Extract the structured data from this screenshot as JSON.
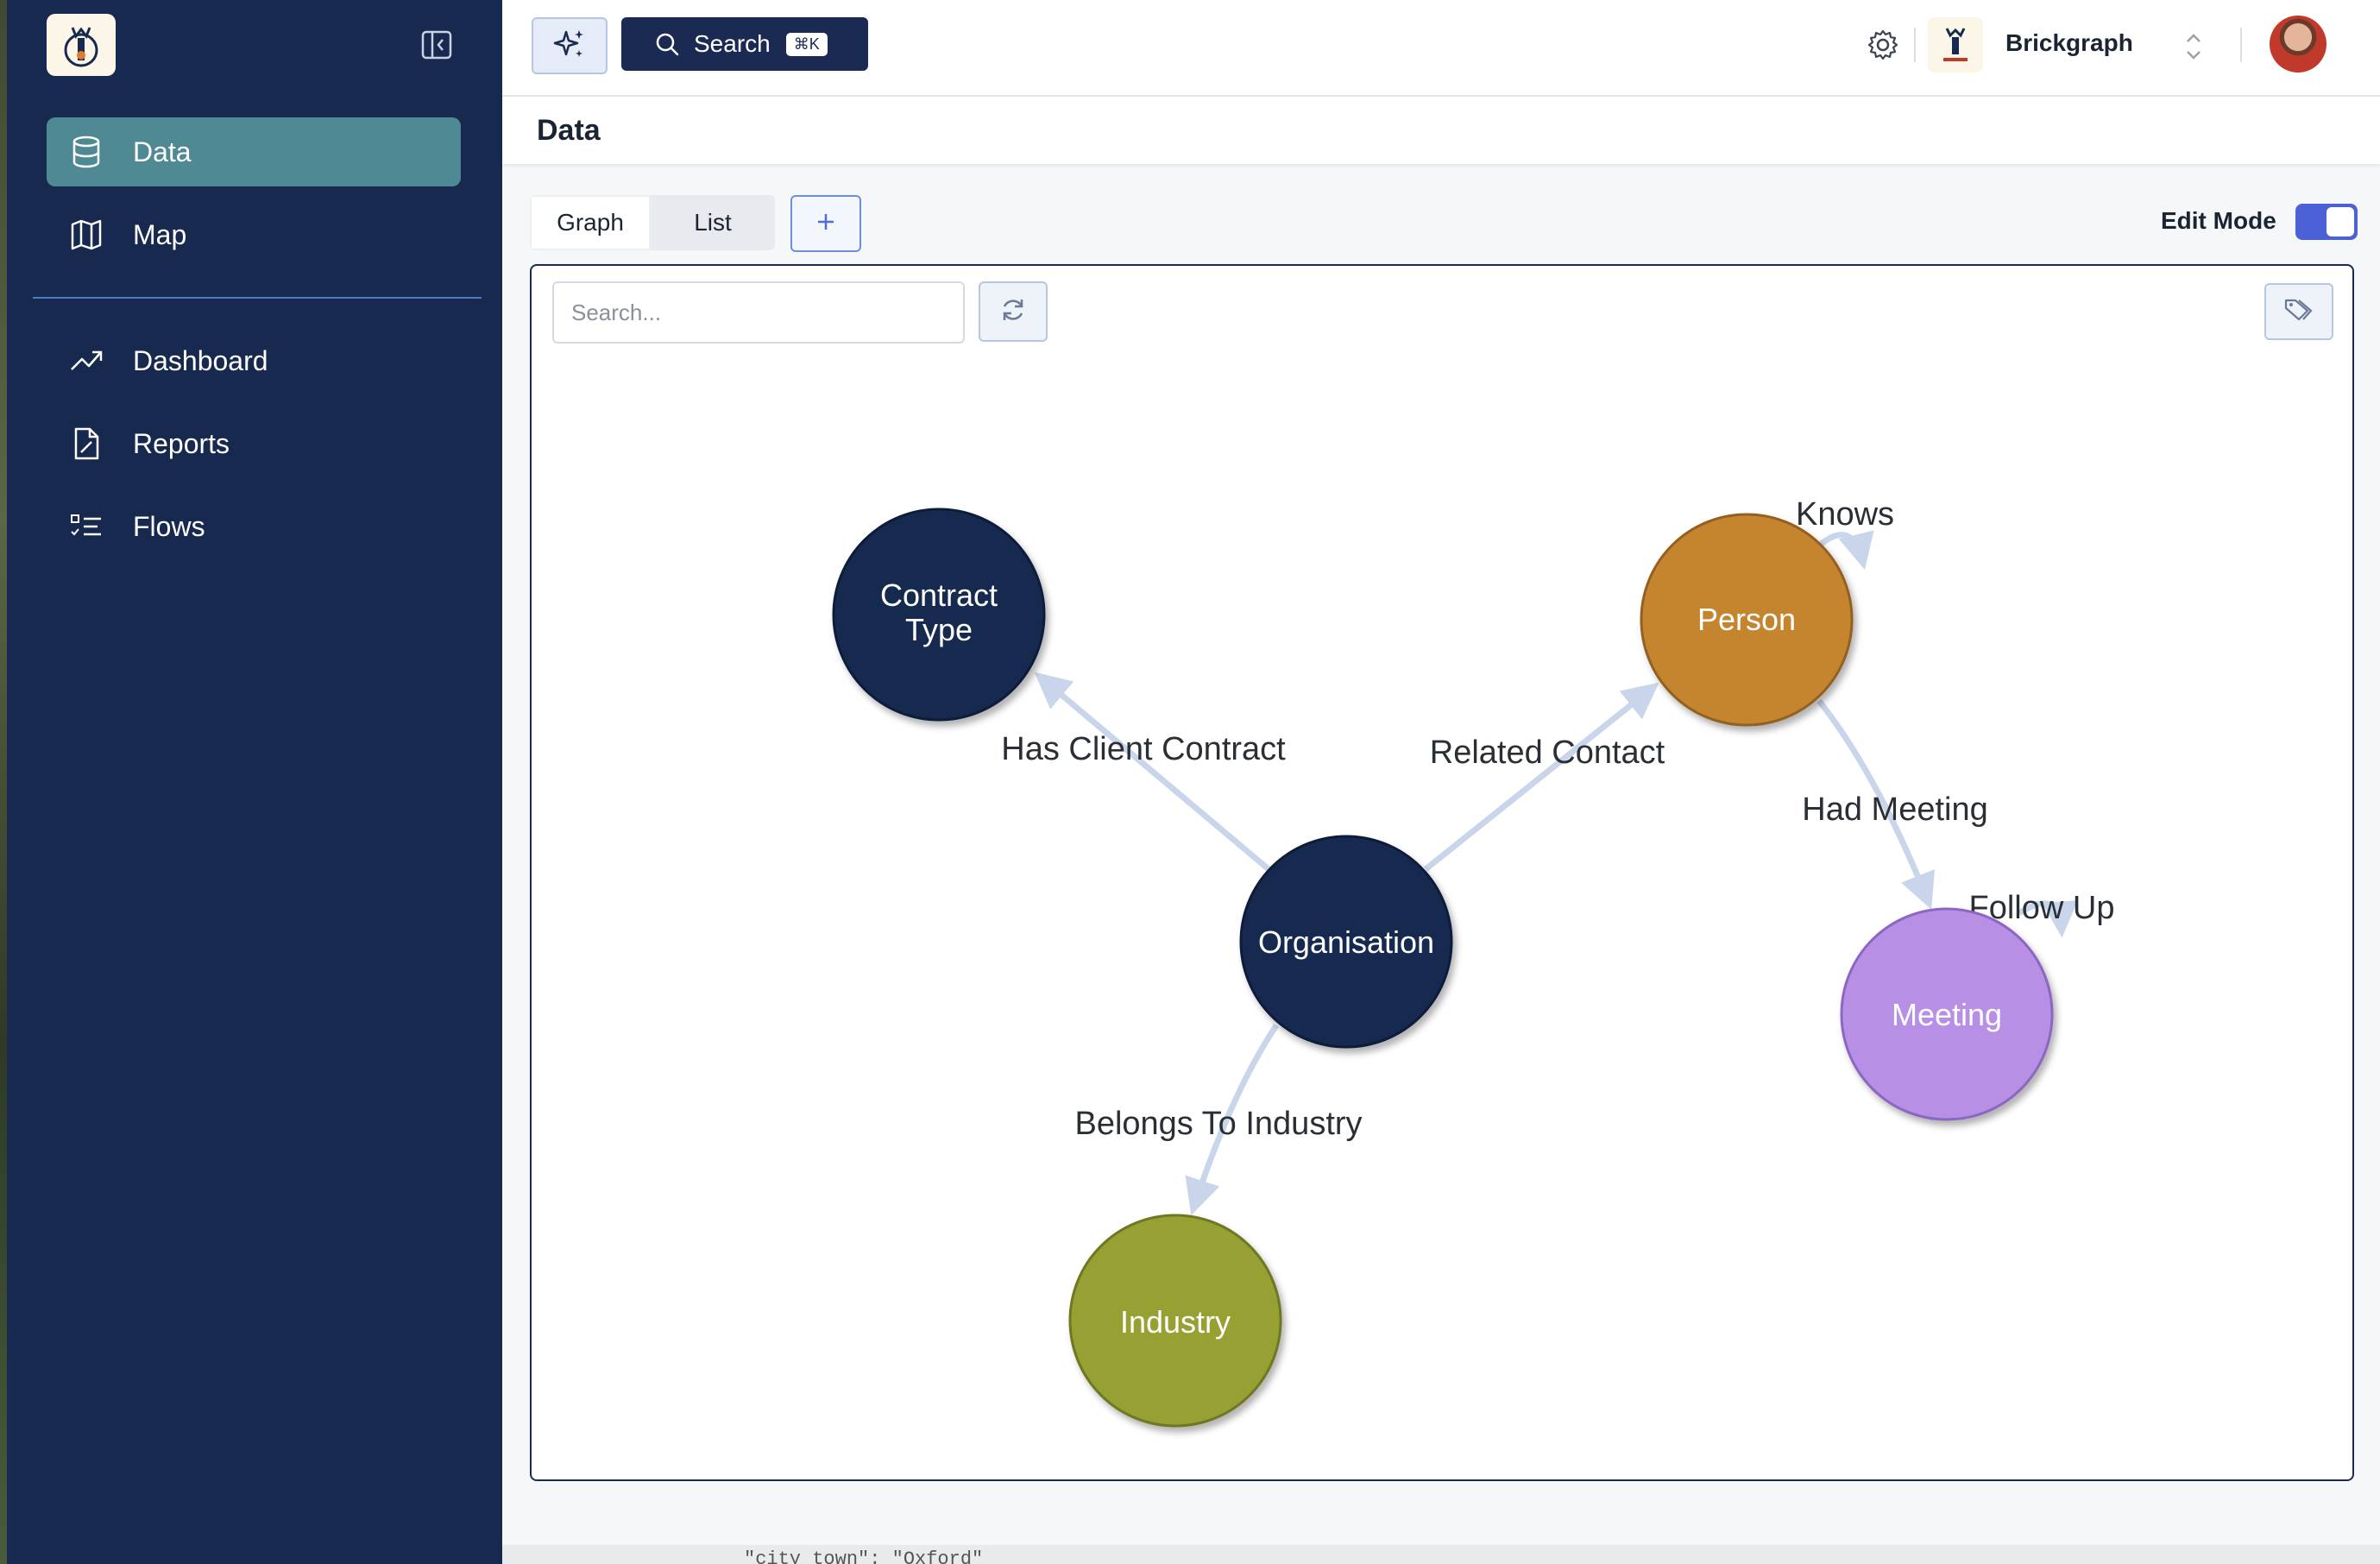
{
  "sidebar": {
    "items_primary": [
      {
        "label": "Data",
        "icon": "database-icon",
        "active": true
      },
      {
        "label": "Map",
        "icon": "map-icon",
        "active": false
      }
    ],
    "items_secondary": [
      {
        "label": "Dashboard",
        "icon": "trending-up-icon"
      },
      {
        "label": "Reports",
        "icon": "report-icon"
      },
      {
        "label": "Flows",
        "icon": "checklist-icon"
      }
    ]
  },
  "topbar": {
    "search_label": "Search",
    "search_shortcut": "⌘K",
    "brand_name": "Brickgraph"
  },
  "page": {
    "title": "Data"
  },
  "view_tabs": {
    "graph": "Graph",
    "list": "List"
  },
  "edit_mode": {
    "label": "Edit Mode",
    "enabled": true
  },
  "graph": {
    "search_placeholder": "Search...",
    "nodes": {
      "contract_type": {
        "line1": "Contract",
        "line2": "Type",
        "color": "#17294f"
      },
      "organisation": {
        "label": "Organisation",
        "color": "#17294f"
      },
      "person": {
        "label": "Person",
        "color": "#c5852f"
      },
      "meeting": {
        "label": "Meeting",
        "color": "#b790e6"
      },
      "industry": {
        "label": "Industry",
        "color": "#97a033"
      }
    },
    "edges": {
      "has_client_contract": "Has Client Contract",
      "related_contact": "Related Contact",
      "had_meeting": "Had Meeting",
      "belongs_to_industry": "Belongs To Industry",
      "knows": "Knows",
      "follow_up": "Follow Up"
    }
  },
  "colors": {
    "sidebar_bg": "#17294f",
    "active_nav": "#4f8a94",
    "accent": "#4d61d6",
    "edge": "#c9d5ea"
  },
  "footer_fragment": "\"city_town\": \"Oxford\""
}
